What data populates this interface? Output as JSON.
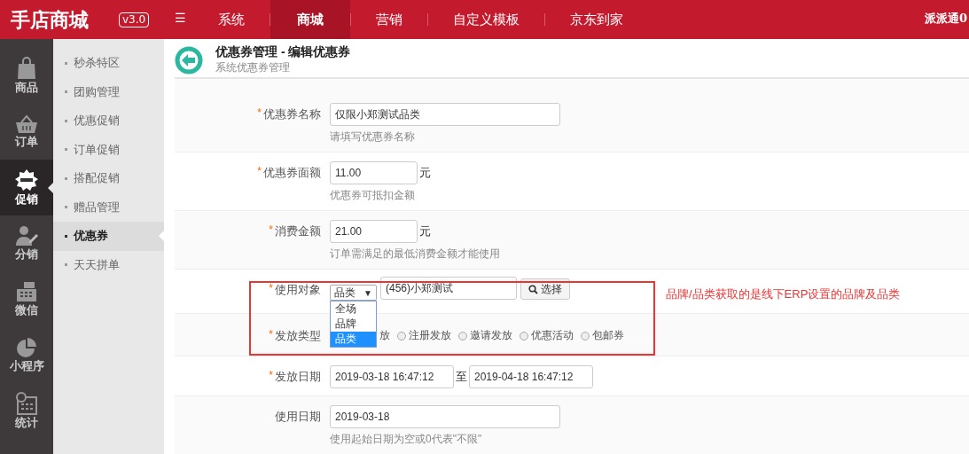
{
  "topbar": {
    "logo": "手店商城",
    "version": "v3.0",
    "menu_icon": "☰",
    "nav": [
      {
        "label": "系统",
        "selected": false
      },
      {
        "label": "商城",
        "selected": true
      },
      {
        "label": "营销",
        "selected": false
      },
      {
        "label": "自定义模板",
        "selected": false
      },
      {
        "label": "京东到家",
        "selected": false
      }
    ],
    "user": "派派通0"
  },
  "sidebar": {
    "items": [
      {
        "label": "商品",
        "kind": "bag",
        "selected": false
      },
      {
        "label": "订单",
        "kind": "basket",
        "selected": false
      },
      {
        "label": "促销",
        "kind": "sale",
        "selected": true
      },
      {
        "label": "分销",
        "kind": "person",
        "selected": false
      },
      {
        "label": "微信",
        "kind": "register",
        "selected": false
      },
      {
        "label": "小程序",
        "kind": "pie",
        "selected": false
      },
      {
        "label": "统计",
        "kind": "calendar",
        "selected": false
      }
    ]
  },
  "submenu": {
    "items": [
      {
        "label": "秒杀特区",
        "selected": false
      },
      {
        "label": "团购管理",
        "selected": false
      },
      {
        "label": "优惠促销",
        "selected": false
      },
      {
        "label": "订单促销",
        "selected": false
      },
      {
        "label": "搭配促销",
        "selected": false
      },
      {
        "label": "赠品管理",
        "selected": false
      },
      {
        "label": "优惠券",
        "selected": true
      },
      {
        "label": "天天拼单",
        "selected": false
      }
    ]
  },
  "header": {
    "title": "优惠券管理 - 编辑优惠券",
    "subtitle": "系统优惠券管理"
  },
  "fields": [
    {
      "kind": "text",
      "label": "优惠券名称",
      "required_mark": "*",
      "value": "仅限小郑测试品类",
      "hint": "请填写优惠券名称"
    },
    {
      "kind": "money",
      "label": "优惠券面额",
      "required_mark": "*",
      "value": "11.00",
      "unit": "元",
      "hint": "优惠券可抵扣金额"
    },
    {
      "kind": "money",
      "label": "消费金额",
      "required_mark": "*",
      "value": "21.00",
      "unit": "元",
      "hint": "订单需满足的最低消费金额才能使用"
    },
    {
      "kind": "target",
      "label": "使用对象",
      "required_mark": "*",
      "select": {
        "value": "品类",
        "arrow": "▼",
        "expanded": true,
        "options": [
          {
            "label": "全场",
            "selected": false
          },
          {
            "label": "品牌",
            "selected": false
          },
          {
            "label": "品类",
            "selected": true
          }
        ]
      },
      "value": "(456)小郑测试",
      "button": "选择"
    },
    {
      "kind": "radios",
      "label": "发放类型",
      "required_mark": "*",
      "covered_text": "放",
      "options": [
        {
          "label": "注册发放",
          "selected": false
        },
        {
          "label": "邀请发放",
          "selected": false
        },
        {
          "label": "优惠活动",
          "selected": false
        },
        {
          "label": "包邮券",
          "selected": false
        }
      ]
    },
    {
      "kind": "daterange",
      "label": "发放日期",
      "required_mark": "*",
      "from": "2019-03-18 16:47:12",
      "separator": "至",
      "to": "2019-04-18 16:47:12"
    },
    {
      "kind": "text",
      "label": "使用日期",
      "value": "2019-03-18",
      "hint": "使用起始日期为空或0代表\"不限\""
    }
  ],
  "annotation": {
    "text": "品牌/品类获取的是线下ERP设置的品牌及品类"
  }
}
